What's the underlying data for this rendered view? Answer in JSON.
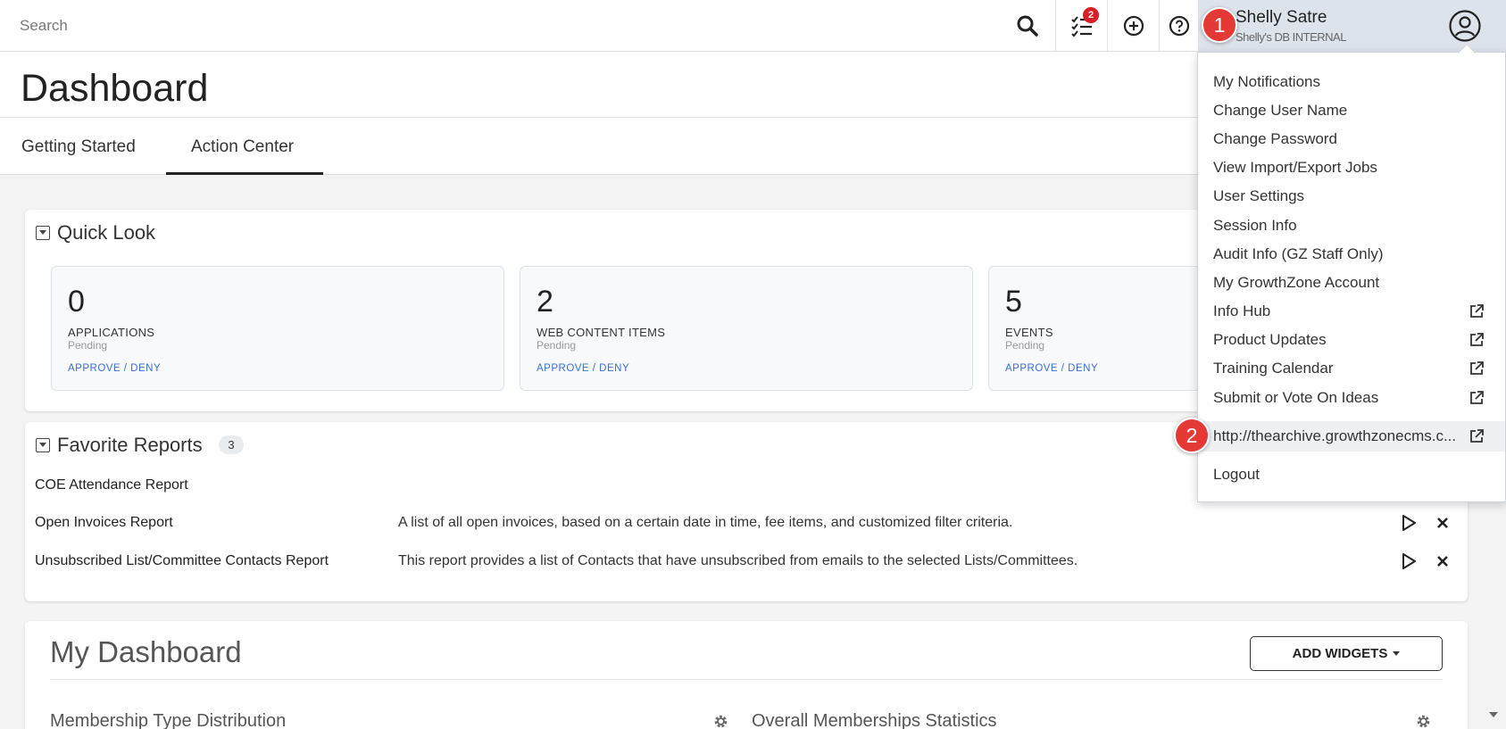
{
  "topbar": {
    "search_placeholder": "Search",
    "tasks_badge_count": "2",
    "icons": [
      "search-icon",
      "tasks-icon",
      "add-icon",
      "help-icon",
      "user-avatar-icon"
    ]
  },
  "user": {
    "name": "Shelly Satre",
    "org": "Shelly's DB INTERNAL"
  },
  "callouts": {
    "one": "1",
    "two": "2"
  },
  "page": {
    "title": "Dashboard",
    "tabs": [
      {
        "label": "Getting Started"
      },
      {
        "label": "Action Center"
      }
    ]
  },
  "quick_look": {
    "title": "Quick Look",
    "stats": [
      {
        "count": "0",
        "label": "APPLICATIONS",
        "sub": "Pending",
        "link": "APPROVE / DENY"
      },
      {
        "count": "2",
        "label": "WEB CONTENT ITEMS",
        "sub": "Pending",
        "link": "APPROVE / DENY"
      },
      {
        "count": "5",
        "label": "EVENTS",
        "sub": "Pending",
        "link": "APPROVE / DENY"
      }
    ]
  },
  "favorite_reports": {
    "title": "Favorite Reports",
    "count": "3",
    "reports": [
      {
        "name": "COE Attendance Report",
        "description": ""
      },
      {
        "name": "Open Invoices Report",
        "description": "A list of all open invoices, based on a certain date in time, fee items, and customized filter criteria."
      },
      {
        "name": "Unsubscribed List/Committee Contacts Report",
        "description": "This report provides a list of Contacts that have unsubscribed from emails to the selected Lists/Committees."
      }
    ]
  },
  "my_dashboard": {
    "title": "My Dashboard",
    "add_widgets_label": "ADD WIDGETS",
    "widgets": [
      {
        "title": "Membership Type Distribution"
      },
      {
        "title": "Overall Memberships Statistics"
      }
    ]
  },
  "user_menu": {
    "items": [
      {
        "label": "My Notifications",
        "external": false
      },
      {
        "label": "Change User Name",
        "external": false
      },
      {
        "label": "Change Password",
        "external": false
      },
      {
        "label": "View Import/Export Jobs",
        "external": false
      },
      {
        "label": "User Settings",
        "external": false
      },
      {
        "label": "Session Info",
        "external": false
      },
      {
        "label": "Audit Info (GZ Staff Only)",
        "external": false
      },
      {
        "label": "My GrowthZone Account",
        "external": false
      },
      {
        "label": "Info Hub",
        "external": true
      },
      {
        "label": "Product Updates",
        "external": true
      },
      {
        "label": "Training Calendar",
        "external": true
      },
      {
        "label": "Submit or Vote On Ideas",
        "external": true
      },
      {
        "label": "http://thearchive.growthzonecms.c...",
        "external": true
      },
      {
        "label": "Logout",
        "external": false
      }
    ]
  },
  "colors": {
    "accent_link": "#3a6fd1",
    "badge_red": "#d61f26",
    "callout_red": "#e53935",
    "user_area_bg": "#dde3ea"
  }
}
